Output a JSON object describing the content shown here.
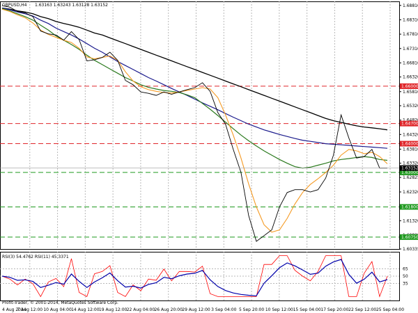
{
  "header": {
    "symbol": "GBPUSD,H4",
    "ohlc": "1.63163 1.63243 1.63128 1.63152"
  },
  "indicator_header": "RSI(3) 54.4762  RSI(11) 45.3371",
  "copyright": "Profit-Trader, © 2001-2014, MetaQuotes Software Corp.",
  "colors": {
    "price": "#000000",
    "ma_fast": "#f59a23",
    "ma_mid": "#2b7a1e",
    "ma_slow": "#1a1a8c",
    "ma_long": "#000000",
    "resistance": "#e0262a",
    "support": "#1f9a1f",
    "rsi_fast": "#ff0000",
    "rsi_slow": "#0000aa"
  },
  "chart_data": {
    "type": "line",
    "ylim": [
      1.60335,
      1.6895
    ],
    "price_ticks": [
      "1.68810",
      "1.68310",
      "1.67810",
      "1.67310",
      "1.66810",
      "1.66320",
      "1.65810",
      "1.65320",
      "1.64820",
      "1.64320",
      "1.63810",
      "1.63320",
      "1.62825",
      "1.62320",
      "1.61825",
      "1.61320",
      "1.60825",
      "1.60335"
    ],
    "x_labels": [
      "4 Aug 2014",
      "7 Aug 12:00",
      "10 Aug 04:00",
      "14 Aug 12:00",
      "19 Aug 12:00",
      "22 Aug 04:00",
      "26 Aug 20:00",
      "29 Aug 12:00",
      "3 Sep 04:00",
      "5 Sep 20:00",
      "10 Sep 12:00",
      "15 Sep 04:00",
      "17 Sep 20:00",
      "22 Sep 12:00",
      "25 Sep 04:00"
    ],
    "levels": [
      {
        "label": "1.66000",
        "value": 1.66,
        "kind": "resistance"
      },
      {
        "label": "1.64700",
        "value": 1.647,
        "kind": "resistance"
      },
      {
        "label": "1.64000",
        "value": 1.64,
        "kind": "resistance"
      },
      {
        "label": "1.63000",
        "value": 1.63,
        "kind": "support"
      },
      {
        "label": "1.61800",
        "value": 1.618,
        "kind": "support"
      },
      {
        "label": "1.60750",
        "value": 1.6075,
        "kind": "support"
      }
    ],
    "current_price": "1.63152",
    "series": [
      {
        "values": [
          1.6872,
          1.6868,
          1.6862,
          1.6858,
          1.6852,
          1.6842,
          1.6835,
          1.6825,
          1.6818,
          1.6812,
          1.6805,
          1.6795,
          1.6785,
          1.6778,
          1.6768,
          1.6758,
          1.6748,
          1.6738,
          1.6728,
          1.6718,
          1.6708,
          1.6698,
          1.6688,
          1.6678,
          1.6668,
          1.6658,
          1.6648,
          1.6638,
          1.6628,
          1.6618,
          1.6608,
          1.6598,
          1.6588,
          1.6578,
          1.6568,
          1.6558,
          1.6548,
          1.6538,
          1.6528,
          1.6518,
          1.6508,
          1.6498,
          1.6488,
          1.648,
          1.6474,
          1.6468,
          1.6462,
          1.6458,
          1.6455,
          1.6452,
          1.6448
        ]
      },
      {
        "values": [
          1.6872,
          1.6866,
          1.6858,
          1.6852,
          1.6844,
          1.683,
          1.6818,
          1.6802,
          1.679,
          1.6778,
          1.6764,
          1.6748,
          1.6732,
          1.6718,
          1.6702,
          1.6686,
          1.6672,
          1.6658,
          1.6644,
          1.663,
          1.6618,
          1.6605,
          1.6592,
          1.658,
          1.6568,
          1.6555,
          1.6542,
          1.653,
          1.6518,
          1.6505,
          1.6492,
          1.648,
          1.6468,
          1.6458,
          1.6448,
          1.644,
          1.6432,
          1.6425,
          1.6418,
          1.6412,
          1.6408,
          1.6404,
          1.64,
          1.6398,
          1.6396,
          1.6394,
          1.6392,
          1.639,
          1.6388,
          1.6386,
          1.6384
        ]
      },
      {
        "values": [
          1.687,
          1.6862,
          1.6852,
          1.6842,
          1.683,
          1.6812,
          1.6795,
          1.6775,
          1.676,
          1.6745,
          1.6728,
          1.6708,
          1.669,
          1.6675,
          1.666,
          1.6645,
          1.663,
          1.6618,
          1.6605,
          1.6596,
          1.659,
          1.6585,
          1.6582,
          1.6578,
          1.657,
          1.656,
          1.654,
          1.652,
          1.6498,
          1.6475,
          1.6452,
          1.643,
          1.641,
          1.6392,
          1.6375,
          1.636,
          1.6345,
          1.6332,
          1.632,
          1.6315,
          1.6318,
          1.6325,
          1.6332,
          1.634,
          1.6345,
          1.6348,
          1.6352,
          1.6355,
          1.6352,
          1.6345,
          1.6342
        ]
      },
      {
        "values": [
          1.6868,
          1.686,
          1.6848,
          1.6838,
          1.682,
          1.6795,
          1.678,
          1.677,
          1.676,
          1.6752,
          1.6732,
          1.6702,
          1.6695,
          1.67,
          1.6705,
          1.669,
          1.665,
          1.6618,
          1.6598,
          1.6588,
          1.6582,
          1.6578,
          1.6576,
          1.658,
          1.6585,
          1.659,
          1.6595,
          1.659,
          1.656,
          1.65,
          1.643,
          1.635,
          1.626,
          1.618,
          1.6118,
          1.6092,
          1.61,
          1.614,
          1.619,
          1.623,
          1.6258,
          1.6278,
          1.63,
          1.6325,
          1.636,
          1.638,
          1.6375,
          1.6365,
          1.637,
          1.6355,
          1.633
        ]
      },
      {
        "values": [
          1.688,
          1.6875,
          1.686,
          1.6855,
          1.6842,
          1.6792,
          1.6782,
          1.6778,
          1.676,
          1.679,
          1.6762,
          1.6688,
          1.6692,
          1.67,
          1.6718,
          1.669,
          1.662,
          1.6605,
          1.658,
          1.6575,
          1.6568,
          1.658,
          1.6572,
          1.658,
          1.6588,
          1.6595,
          1.6612,
          1.6582,
          1.6508,
          1.6468,
          1.638,
          1.63,
          1.615,
          1.606,
          1.608,
          1.61,
          1.618,
          1.623,
          1.624,
          1.624,
          1.6232,
          1.624,
          1.628,
          1.636,
          1.65,
          1.642,
          1.635,
          1.6355,
          1.638,
          1.6315,
          1.6315
        ]
      }
    ],
    "rsi": {
      "levels": [
        "65",
        "50",
        "35"
      ],
      "ylim": [
        0,
        100
      ]
    }
  }
}
